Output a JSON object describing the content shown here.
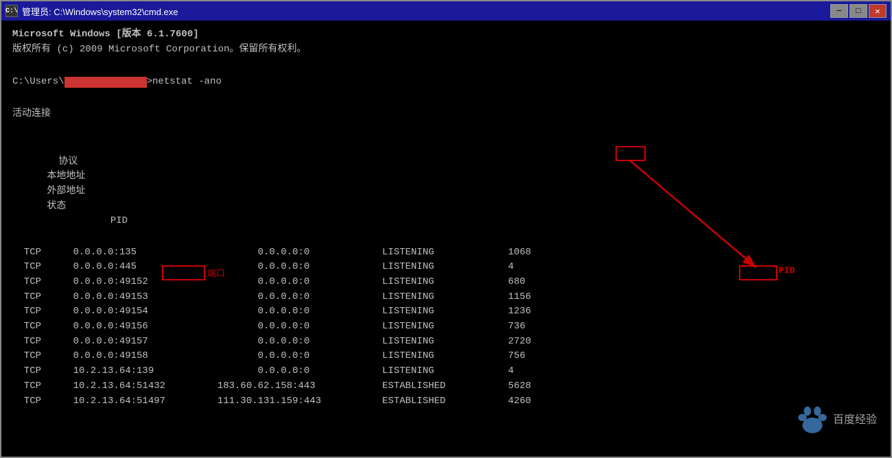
{
  "window": {
    "title": "管理员: C:\\Windows\\system32\\cmd.exe",
    "title_icon": "C:\\",
    "btn_minimize": "─",
    "btn_maximize": "□",
    "btn_close": "✕"
  },
  "terminal": {
    "line1": "Microsoft Windows [版本 6.1.7600]",
    "line2": "版权所有 (c) 2009 Microsoft Corporation。保留所有权利。",
    "line3": "",
    "prompt": "C:\\Users\\",
    "redacted": "████████████",
    "prompt_suffix": ">netstat -ano",
    "line5": "",
    "section_title": "活动连接",
    "line6": "",
    "col_protocol": "  协议",
    "col_local": "  本地地址",
    "col_foreign": "            外部地址",
    "col_state": "          状态",
    "col_pid": "           PID",
    "rows": [
      {
        "protocol": "  TCP",
        "local": "    0.0.0.0:135",
        "foreign": "              0.0.0.0:0",
        "state": "          LISTENING",
        "pid": "           1068"
      },
      {
        "protocol": "  TCP",
        "local": "    0.0.0.0:445",
        "foreign": "              0.0.0.0:0",
        "state": "          LISTENING",
        "pid": "           4"
      },
      {
        "protocol": "  TCP",
        "local": "    0.0.0.0:49152",
        "foreign": "              0.0.0.0:0",
        "state": "          LISTENING",
        "pid": "           680"
      },
      {
        "protocol": "  TCP",
        "local": "    0.0.0.0:49153",
        "foreign": "              0.0.0.0:0",
        "state": "          LISTENING",
        "pid": "           1156"
      },
      {
        "protocol": "  TCP",
        "local": "    0.0.0.0:49154",
        "foreign": "              0.0.0.0:0",
        "state": "          LISTENING",
        "pid": "           1236"
      },
      {
        "protocol": "  TCP",
        "local": "    0.0.0.0:49156",
        "foreign": "              0.0.0.0:0",
        "state": "          LISTENING",
        "pid": "           736"
      },
      {
        "protocol": "  TCP",
        "local": "    0.0.0.0:49157",
        "foreign": "              0.0.0.0:0",
        "state": "          LISTENING",
        "pid": "           2720"
      },
      {
        "protocol": "  TCP",
        "local": "    0.0.0.0:49158",
        "foreign": "              0.0.0.0:0",
        "state": "          LISTENING",
        "pid": "           756"
      },
      {
        "protocol": "  TCP",
        "local": "    10.2.13.64:139",
        "foreign": "              0.0.0.0:0",
        "state": "          LISTENING",
        "pid": "           4"
      },
      {
        "protocol": "  TCP",
        "local": "    10.2.13.64:51432",
        "foreign": "         183.60.62.158:443",
        "state": "          ESTABLISHED",
        "pid": "           5628"
      },
      {
        "protocol": "  TCP",
        "local": "    10.2.13.64:51497",
        "foreign": "         111.30.131.159:443",
        "state": "          ESTABLISHED",
        "pid": "           4260"
      }
    ],
    "annotation_port_label": "端口",
    "annotation_pid_label": "PID"
  },
  "colors": {
    "terminal_bg": "#000000",
    "terminal_fg": "#c0c0c0",
    "title_bg": "#1a1a9a",
    "annotation_red": "#cc0000"
  }
}
